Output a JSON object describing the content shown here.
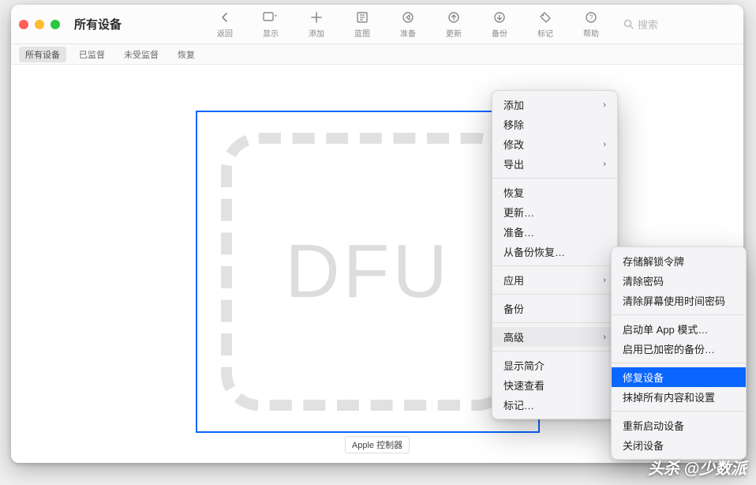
{
  "window": {
    "title": "所有设备"
  },
  "toolbar": {
    "back": "返回",
    "view": "显示",
    "add": "添加",
    "blueprint": "蓝图",
    "prepare": "准备",
    "update": "更新",
    "backup": "备份",
    "tag": "标记",
    "help": "帮助"
  },
  "search": {
    "placeholder": "搜索"
  },
  "scope": {
    "items": [
      "所有设备",
      "已监督",
      "未受监督",
      "恢复"
    ],
    "selected_index": 0
  },
  "device": {
    "badge": "DFU",
    "caption": "Apple 控制器"
  },
  "context_menu": {
    "group1": [
      {
        "label": "添加",
        "submenu": true
      },
      {
        "label": "移除",
        "submenu": false
      },
      {
        "label": "修改",
        "submenu": true
      },
      {
        "label": "导出",
        "submenu": true
      }
    ],
    "group2": [
      {
        "label": "恢复"
      },
      {
        "label": "更新…"
      },
      {
        "label": "准备…"
      },
      {
        "label": "从备份恢复…"
      }
    ],
    "group3": [
      {
        "label": "应用",
        "submenu": true
      }
    ],
    "group4": [
      {
        "label": "备份"
      }
    ],
    "group5": [
      {
        "label": "高级",
        "submenu": true,
        "selected": true
      }
    ],
    "group6": [
      {
        "label": "显示简介"
      },
      {
        "label": "快速查看"
      },
      {
        "label": "标记…"
      }
    ]
  },
  "submenu_advanced": {
    "group1": [
      {
        "label": "存储解锁令牌"
      },
      {
        "label": "清除密码"
      },
      {
        "label": "清除屏幕使用时间密码"
      }
    ],
    "group2": [
      {
        "label": "启动单 App 模式…"
      },
      {
        "label": "启用已加密的备份…"
      }
    ],
    "group3": [
      {
        "label": "修复设备",
        "highlight": true
      },
      {
        "label": "抹掉所有内容和设置"
      }
    ],
    "group4": [
      {
        "label": "重新启动设备"
      },
      {
        "label": "关闭设备"
      }
    ]
  },
  "watermark": "头杀 @少数派"
}
